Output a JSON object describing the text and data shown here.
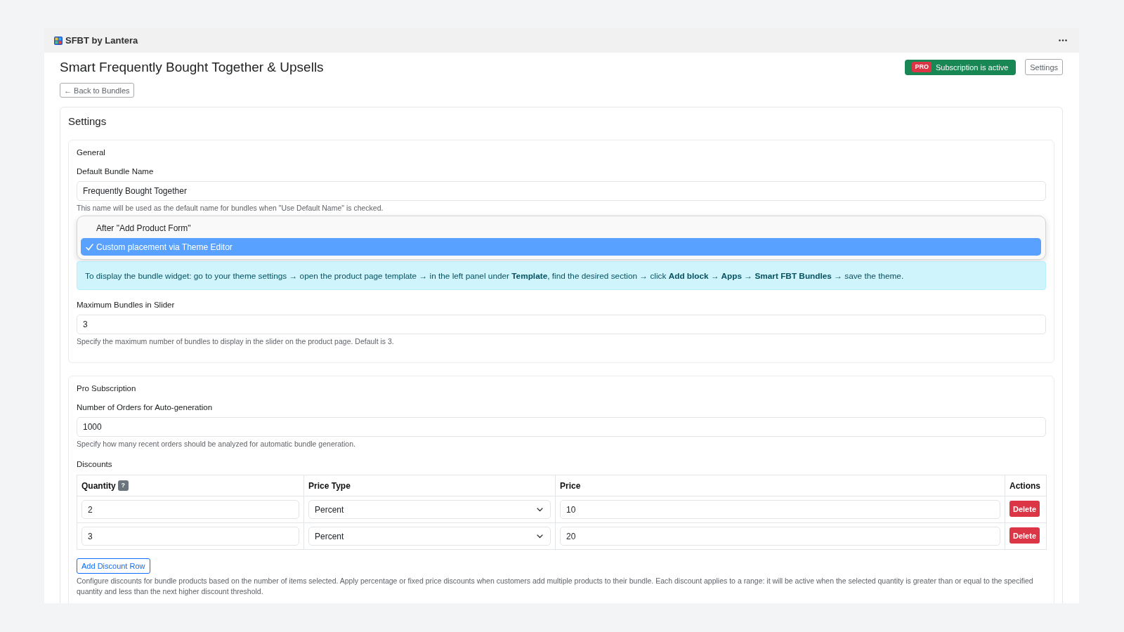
{
  "app_bar": {
    "title": "SFBT by Lantera"
  },
  "header": {
    "title": "Smart Frequently Bought Together & Upsells",
    "subscription": {
      "tag": "PRO",
      "label": "Subscription is active"
    },
    "settings_button": "Settings",
    "back_button": "← Back to Bundles"
  },
  "settings": {
    "title": "Settings",
    "sections": [
      {
        "title": "General",
        "items": [
          {
            "kind": "input",
            "label": "Default Bundle Name",
            "value": "Frequently Bought Together",
            "help": "This name will be used as the default name for bundles when \"Use Default Name\" is checked."
          },
          {
            "kind": "menu",
            "options": [
              {
                "label": "After \"Add Product Form\"",
                "selected": false
              },
              {
                "label": "Custom placement via Theme Editor",
                "selected": true
              }
            ]
          },
          {
            "kind": "alert",
            "text": "To display the bundle widget: go to your theme settings → open the product page template → in the left panel under **Template**, find the desired section → click **Add block → Apps → Smart FBT Bundles** → save the theme."
          },
          {
            "kind": "input",
            "label": "Maximum Bundles in Slider",
            "value": "3",
            "help": "Specify the maximum number of bundles to display in the slider on the product page. Default is 3."
          }
        ]
      },
      {
        "title": "Pro Subscription",
        "items": [
          {
            "kind": "input",
            "label": "Number of Orders for Auto-generation",
            "value": "1000",
            "help": "Specify how many recent orders should be analyzed for automatic bundle generation."
          },
          {
            "kind": "discounts",
            "label": "Discounts",
            "columns": [
              {
                "label": "Quantity",
                "help": "?"
              },
              {
                "label": "Price Type"
              },
              {
                "label": "Price"
              },
              {
                "label": "Actions"
              }
            ],
            "rows": [
              {
                "quantity": "2",
                "price_type": "Percent",
                "price": "10",
                "action": "Delete"
              },
              {
                "quantity": "3",
                "price_type": "Percent",
                "price": "20",
                "action": "Delete"
              }
            ],
            "add_button": "Add Discount Row",
            "help": "Configure discounts for bundle products based on the number of items selected. Apply percentage or fixed price discounts when customers add multiple products to their bundle. Each discount applies to a range: it will be active when the selected quantity is greater than or equal to the specified quantity and less than the next higher discount threshold."
          }
        ]
      }
    ]
  }
}
